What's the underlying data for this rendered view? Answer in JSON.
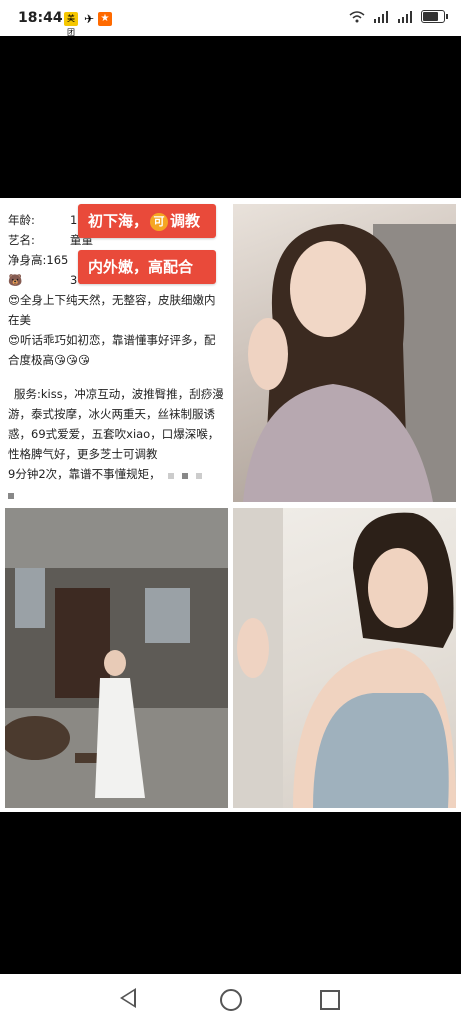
{
  "statusbar": {
    "time": "18:44",
    "app1": "美团",
    "app2": "✈",
    "app3": "★"
  },
  "profile": {
    "age_label": "年龄:",
    "age": "18",
    "name_label": "艺名:",
    "name": "童童",
    "height_label": "净身高:165",
    "size_icon": "🐻",
    "size": "36D",
    "line1": "😍全身上下纯天然，无整容，皮肤细嫩内在美",
    "line2": "😍听话乖巧如初恋，靠谱懂事好评多，配合度极高😘😘😘",
    "services": "服务:kiss，冲凉互动，波推臀推，刮痧漫游，泰式按摩，冰火两重天，丝袜制服诱惑，69式爱爱，五套吹xiao，口爆深喉，性格脾气好，更多芝士可调教",
    "extra": "9分钟2次，靠谱不事懂规矩，"
  },
  "badges": {
    "badge1_a": "初下海，",
    "badge1_circle": "可",
    "badge1_b": "调教",
    "badge2": "内外嫩，高配合"
  },
  "photos": {
    "photo1": "portrait-photo",
    "photo2": "outdoor-photo",
    "photo3": "tanktop-photo"
  }
}
